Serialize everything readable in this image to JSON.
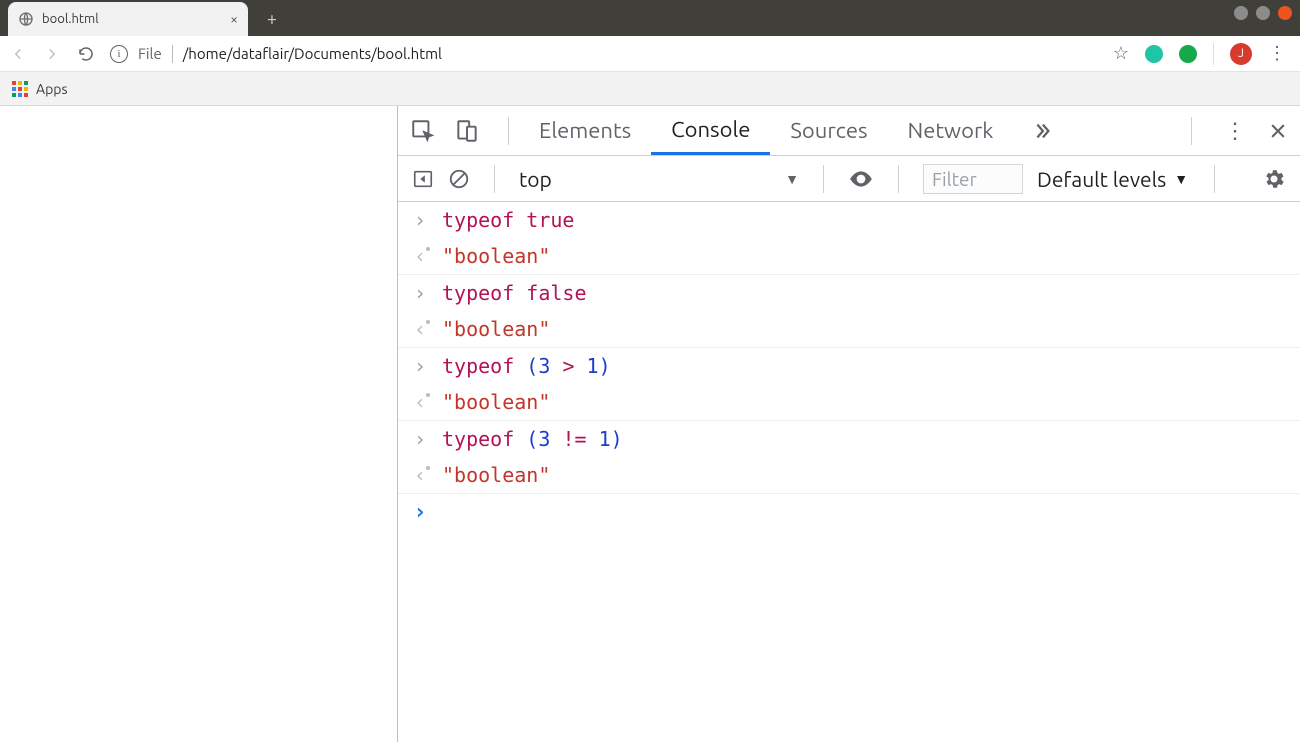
{
  "tab": {
    "title": "bool.html"
  },
  "url": {
    "scheme": "File",
    "path": "/home/dataflair/Documents/bool.html"
  },
  "bookmarks": {
    "apps_label": "Apps"
  },
  "avatar": {
    "initial": "J"
  },
  "devtools": {
    "tabs": {
      "elements": "Elements",
      "console": "Console",
      "sources": "Sources",
      "network": "Network"
    },
    "toolbar": {
      "context": "top",
      "filter_placeholder": "Filter",
      "levels_label": "Default levels"
    },
    "entries": [
      {
        "input_tokens": [
          {
            "t": "typeof",
            "c": "kw"
          },
          {
            "t": " ",
            "c": ""
          },
          {
            "t": "true",
            "c": "kw"
          }
        ],
        "output_tokens": [
          {
            "t": "\"boolean\"",
            "c": "str"
          }
        ]
      },
      {
        "input_tokens": [
          {
            "t": "typeof",
            "c": "kw"
          },
          {
            "t": " ",
            "c": ""
          },
          {
            "t": "false",
            "c": "kw"
          }
        ],
        "output_tokens": [
          {
            "t": "\"boolean\"",
            "c": "str"
          }
        ]
      },
      {
        "input_tokens": [
          {
            "t": "typeof",
            "c": "kw"
          },
          {
            "t": " ",
            "c": ""
          },
          {
            "t": "(",
            "c": "paren"
          },
          {
            "t": "3",
            "c": "num"
          },
          {
            "t": " ",
            "c": ""
          },
          {
            "t": ">",
            "c": "op"
          },
          {
            "t": " ",
            "c": ""
          },
          {
            "t": "1",
            "c": "num"
          },
          {
            "t": ")",
            "c": "paren"
          }
        ],
        "output_tokens": [
          {
            "t": "\"boolean\"",
            "c": "str"
          }
        ]
      },
      {
        "input_tokens": [
          {
            "t": "typeof",
            "c": "kw"
          },
          {
            "t": " ",
            "c": ""
          },
          {
            "t": "(",
            "c": "paren"
          },
          {
            "t": "3",
            "c": "num"
          },
          {
            "t": " ",
            "c": ""
          },
          {
            "t": "!=",
            "c": "op"
          },
          {
            "t": " ",
            "c": ""
          },
          {
            "t": "1",
            "c": "num"
          },
          {
            "t": ")",
            "c": "paren"
          }
        ],
        "output_tokens": [
          {
            "t": "\"boolean\"",
            "c": "str"
          }
        ]
      }
    ]
  }
}
